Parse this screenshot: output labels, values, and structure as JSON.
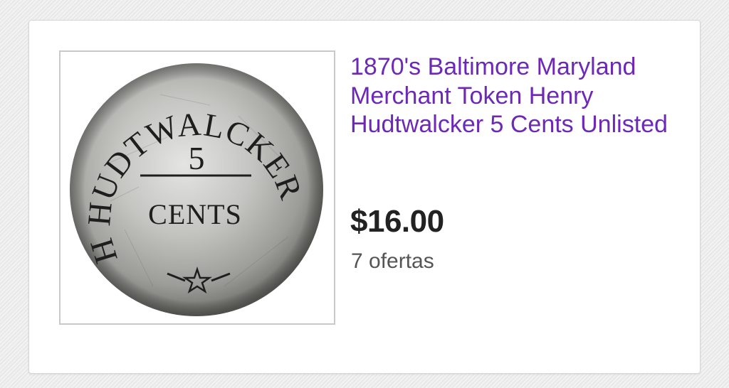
{
  "listing": {
    "title": "1870's Baltimore Maryland Merchant Token Henry Hudtwalcker 5 Cents Unlisted",
    "price": "$16.00",
    "bids": "7 ofertas",
    "coin": {
      "arc_text": "H HUDTWALCKER",
      "denomination": "5",
      "unit": "CENTS"
    }
  },
  "colors": {
    "title": "#6d28b8",
    "price": "#222222",
    "bids": "#555555"
  }
}
